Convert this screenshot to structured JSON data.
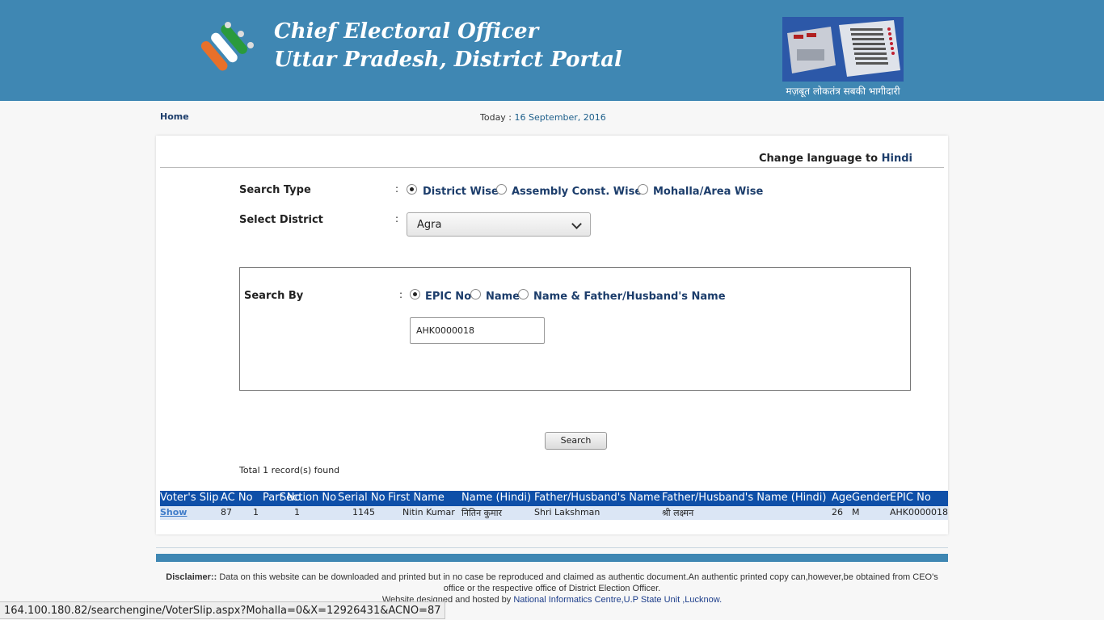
{
  "header": {
    "title_line1": "Chief Electoral Officer",
    "title_line2": "Uttar Pradesh, District Portal",
    "tagline": "मज़बूत लोकतंत्र सबकी भागीदारी",
    "logo_icon": "eci-logo-icon",
    "evm_icon": "evm-machine-icon"
  },
  "nav": {
    "home": "Home",
    "today_label": "Today :",
    "today_date": "16 September, 2016"
  },
  "lang": {
    "prefix": "Change language to",
    "link": "Hindi"
  },
  "form": {
    "search_type_label": "Search Type",
    "search_type_options": [
      "District Wise",
      "Assembly Const. Wise",
      "Mohalla/Area Wise"
    ],
    "search_type_selected": "District Wise",
    "district_label": "Select District",
    "district_value": "Agra",
    "search_by_label": "Search By",
    "search_by_options": [
      "EPIC No",
      "Name",
      "Name & Father/Husband's Name"
    ],
    "search_by_selected": "EPIC No",
    "epic_value": "AHK0000018",
    "colon": ":",
    "search_button": "Search",
    "total": "Total 1 record(s) found"
  },
  "results": {
    "columns": [
      "Voter's Slip",
      "AC No",
      "Part No",
      "Section No",
      "Serial No",
      "First Name",
      "Name (Hindi)",
      "Father/Husband's Name",
      "Father/Husband's Name (Hindi)",
      "Age",
      "Gender",
      "EPIC No"
    ],
    "rows": [
      [
        "Show",
        "87",
        "1",
        "1",
        "1145",
        "Nitin Kumar",
        "नितिन कुमार",
        "Shri Lakshman",
        "श्री लक्ष्मन",
        "26",
        "M",
        "AHK0000018"
      ]
    ]
  },
  "footer": {
    "disclaimer_label": "Disclaimer::",
    "disclaimer_text": "Data on this website can be downloaded and printed but in no case be reproduced and claimed as authentic document.An authentic printed copy can,however,be obtained from CEO's office or the respective office of District Election Officer.",
    "hosted_prefix": "Website designed and hosted by",
    "hosted_link": "National Informatics Centre,U.P State Unit ,Lucknow."
  },
  "statusbar": {
    "url": "164.100.180.82/searchengine/VoterSlip.aspx?Mohalla=0&X=12926431&ACNO=87"
  },
  "colors": {
    "header_bg": "#3f87b3",
    "grid_header": "#0e4fa8",
    "grid_row": "#dbe6f5",
    "link": "#1c3d6b"
  }
}
